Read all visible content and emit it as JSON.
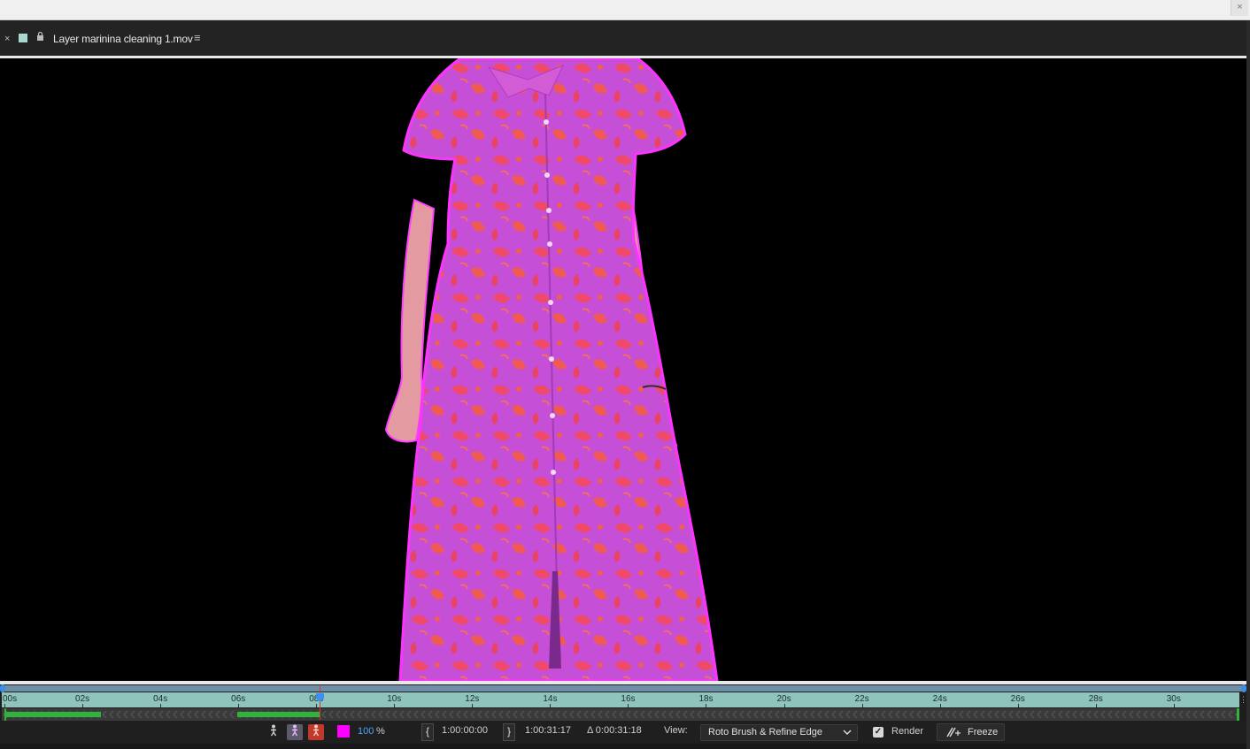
{
  "window": {
    "close_glyph": "×"
  },
  "panel": {
    "close_glyph": "×",
    "lock_icon": "lock-icon",
    "title": "Layer marinina cleaning 1.mov",
    "menu_glyph": "≡",
    "label_color": "#a9d8d0"
  },
  "timeline": {
    "ruler_labels": [
      "00s",
      "02s",
      "04s",
      "06s",
      "08s",
      "10s",
      "12s",
      "14s",
      "16s",
      "18s",
      "20s",
      "22s",
      "24s",
      "26s",
      "28s",
      "30s"
    ],
    "current_time_label": "08s",
    "end_glyph": "⋮",
    "colors": {
      "ruler": "#8fc4bd",
      "propagated": "#2fb33a",
      "playhead": "#3b8ff0",
      "current_time_line": "#e03030"
    }
  },
  "controls": {
    "overlay_color": "#ff00ff",
    "overlay_opacity": "100",
    "overlay_unit": "%",
    "start_bracket": "{",
    "start_time": "1:00:00:00",
    "end_bracket": "}",
    "end_time": "1:00:31:17",
    "duration": "Δ 0:00:31:18",
    "view_label": "View:",
    "view_value": "Roto Brush & Refine Edge",
    "view_chevron": "⌄",
    "render_checked": "✓",
    "render_label": "Render",
    "freeze_label": "Freeze"
  }
}
